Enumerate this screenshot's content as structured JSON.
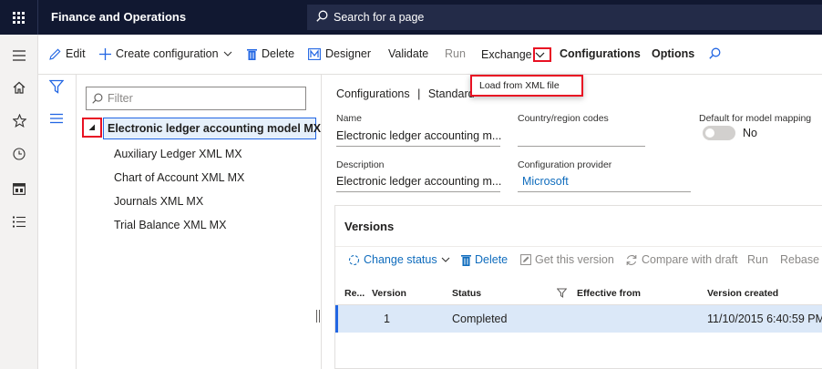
{
  "header": {
    "app_title": "Finance and Operations",
    "search_placeholder": "Search for a page"
  },
  "rail_icons": [
    "waffle-icon",
    "hamburger-icon",
    "home-icon",
    "star-icon",
    "clock-icon",
    "workspace-icon",
    "list-icon"
  ],
  "toolbar": {
    "edit": "Edit",
    "create_configuration": "Create configuration",
    "delete": "Delete",
    "designer": "Designer",
    "validate": "Validate",
    "run": "Run",
    "exchange": "Exchange",
    "configurations": "Configurations",
    "options": "Options"
  },
  "exchange_menu": {
    "load_from_xml": "Load from XML file"
  },
  "tree": {
    "filter_placeholder": "Filter",
    "root": "Electronic ledger accounting model MX",
    "children": [
      "Auxiliary Ledger XML MX",
      "Chart of Account XML MX",
      "Journals XML MX",
      "Trial Balance XML MX"
    ]
  },
  "details": {
    "breadcrumb_root": "Configurations",
    "breadcrumb_separator": "|",
    "breadcrumb_current": "Standard",
    "name_label": "Name",
    "name_value": "Electronic ledger accounting m...",
    "country_label": "Country/region codes",
    "country_value": "",
    "default_mapping_label": "Default for model mapping",
    "default_mapping_value": "No",
    "description_label": "Description",
    "description_value": "Electronic ledger accounting m...",
    "provider_label": "Configuration provider",
    "provider_value": "Microsoft"
  },
  "versions": {
    "title": "Versions",
    "toolbar": {
      "change_status": "Change status",
      "delete": "Delete",
      "get_this_version": "Get this version",
      "compare_with_draft": "Compare with draft",
      "run": "Run",
      "rebase": "Rebase"
    },
    "columns": [
      "Re...",
      "Version",
      "Status",
      "Effective from",
      "Version created"
    ],
    "rows": [
      {
        "re": "",
        "version": "1",
        "status": "Completed",
        "effective_from": "",
        "version_created": "11/10/2015 6:40:59 PM"
      }
    ]
  }
}
